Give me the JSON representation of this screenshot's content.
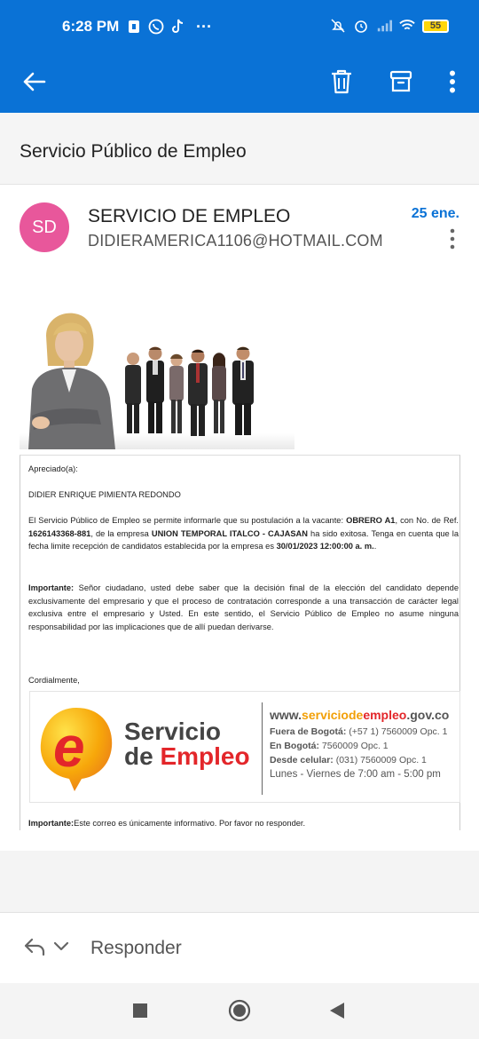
{
  "status_bar": {
    "time": "6:28 PM",
    "more": "···",
    "battery": "55",
    "icons": [
      "sim-icon",
      "whatsapp-icon",
      "tiktok-icon",
      "mute-icon",
      "alarm-icon",
      "signal-icon",
      "wifi-icon",
      "battery-icon"
    ]
  },
  "toolbar": {
    "icons": [
      "back-arrow-icon",
      "delete-icon",
      "archive-icon",
      "more-vert-icon"
    ]
  },
  "subject": "Servicio Público de Empleo",
  "message": {
    "avatar_initials": "SD",
    "sender": "SERVICIO DE EMPLEO",
    "email": "DIDIERAMERICA1106@HOTMAIL.COM",
    "date": "25 ene."
  },
  "body": {
    "greeting": "Apreciado(a):",
    "name": "DIDIER ENRIQUE PIMIENTA REDONDO",
    "p1_a": "El Servicio Público de Empleo se permite informarle que su postulación a la vacante: ",
    "p1_b": "OBRERO A1",
    "p1_c": ", con No. de Ref. ",
    "p1_d": "1626143368-881",
    "p1_e": ", de la empresa ",
    "p1_f": "UNION TEMPORAL ITALCO - CAJASAN",
    "p1_g": " ha sido exitosa. Tenga en cuenta que la fecha limite recepción de candidatos establecida por la empresa es ",
    "p1_h": "30/01/2023 12:00:00 a. m.",
    "p1_i": ".",
    "p2_a": "Importante:",
    "p2_b": " Señor ciudadano, usted debe saber que la decisión final de la elección del candidato depende exclusivamente del empresario y que el proceso de contratación corresponde a una transacción de carácter legal exclusiva entre el empresario y Usted. En este sentido, el Servicio Público de Empleo no asume ninguna responsabilidad por las implicaciones que de allí puedan derivarse.",
    "closing": "Cordialmente,",
    "footer_a": "Importante:",
    "footer_b": "Este correo es únicamente informativo. Por favor no responder."
  },
  "logo": {
    "letter": "e",
    "line1": "Servicio",
    "line2_a": "de ",
    "line2_b": "Empleo",
    "site_a": "www.",
    "site_b": "serviciode",
    "site_c": "empleo",
    "site_d": ".gov.co",
    "c1_label": "Fuera de Bogotá:",
    "c1_value": " (+57 1) 7560009 Opc. 1",
    "c2_label": "En Bogotá:",
    "c2_value": " 7560009 Opc. 1",
    "c3_label": "Desde celular:",
    "c3_value": " (031) 7560009 Opc. 1",
    "hours": "Lunes - Viernes de 7:00 am - 5:00 pm"
  },
  "reply": {
    "label": "Responder"
  },
  "colors": {
    "accent": "#0a72d6",
    "avatar": "#e8579b",
    "logo_red": "#e3262a",
    "logo_orange": "#f29f05"
  }
}
